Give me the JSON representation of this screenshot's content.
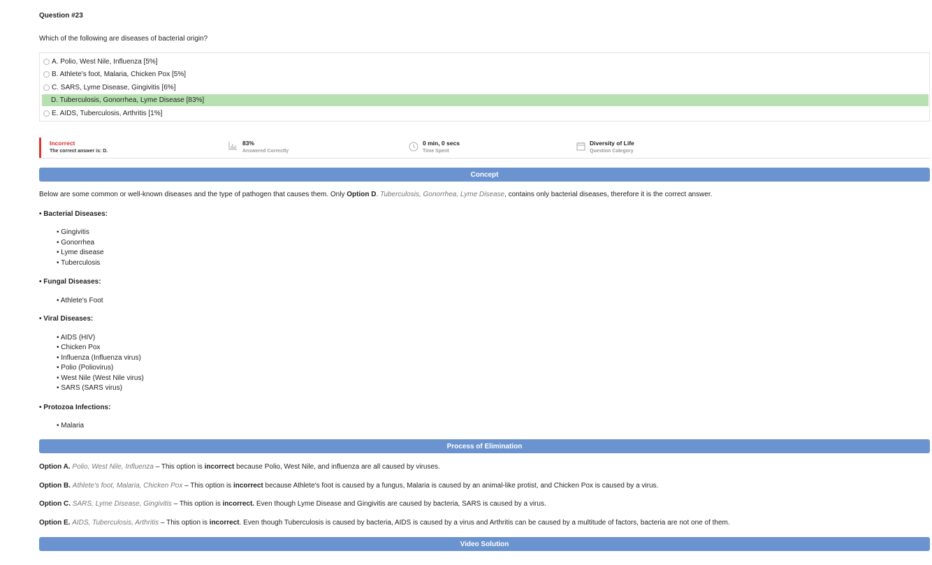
{
  "question": {
    "number": "Question #23",
    "text": "Which of the following are diseases of bacterial origin?",
    "options": [
      {
        "label": "A. Polio, West Nile, Influenza [5%]",
        "selected": false
      },
      {
        "label": "B. Athlete's foot, Malaria, Chicken Pox [5%]",
        "selected": false
      },
      {
        "label": "C. SARS, Lyme Disease, Gingivitis [6%]",
        "selected": false
      },
      {
        "label": "D. Tuberculosis, Gonorrhea, Lyme Disease [83%]",
        "selected": true
      },
      {
        "label": "E. AIDS, Tuberculosis, Arthritis [1%]",
        "selected": false
      }
    ]
  },
  "result": {
    "status": "Incorrect",
    "correct_answer": "The correct answer is: D.",
    "percent": "83%",
    "percent_label": "Answered Correctly",
    "time": "0 min, 0 secs",
    "time_label": "Time Spent",
    "category": "Diversity of Life",
    "category_label": "Question Category",
    "status_color": "#d9302b"
  },
  "concept": {
    "header": "Concept",
    "intro_1": "Below are some common or well-known diseases and the type of pathogen that causes them. Only ",
    "intro_bold": "Option D",
    "intro_2": ". ",
    "intro_italic": "Tuberculosis, Gonorrhea, Lyme Disease",
    "intro_3": ", contains only bacterial diseases, therefore it is the correct answer.",
    "groups": [
      {
        "title": "• Bacterial Diseases:",
        "items": [
          "• Gingivitis",
          "• Gonorrhea",
          "• Lyme disease",
          "• Tuberculosis"
        ]
      },
      {
        "title": "• Fungal Diseases:",
        "items": [
          "• Athlete's Foot"
        ]
      },
      {
        "title": "• Viral Diseases:",
        "items": [
          "• AIDS (HIV)",
          "• Chicken Pox",
          "• Influenza (Influenza virus)",
          "• Polio (Poliovirus)",
          "• West Nile (West Nile virus)",
          "• SARS (SARS virus)"
        ]
      },
      {
        "title": "• Protozoa Infections:",
        "items": [
          "• Malaria"
        ]
      }
    ]
  },
  "elimination": {
    "header": "Process of Elimination",
    "items": [
      {
        "label": "Option A.",
        "italic": "Polio, West Nile, Influenza",
        "pre": " – This option is ",
        "bold": "incorrect",
        "post": " because Polio, West Nile, and influenza are all caused by viruses."
      },
      {
        "label": "Option B.",
        "italic": "Athlete's foot, Malaria, Chicken Pox",
        "pre": " – This option is ",
        "bold": "incorrect",
        "post": " because Athlete's foot is caused by a fungus, Malaria is caused by an animal-like protist, and Chicken Pox is caused by a virus."
      },
      {
        "label": "Option C.",
        "italic": "SARS, Lyme Disease, Gingivitis",
        "pre": " – This option is ",
        "bold": "incorrect.",
        "post": " Even though Lyme Disease and Gingivitis are caused by bacteria, SARS is caused by a virus."
      },
      {
        "label": "Option E.",
        "italic": "AIDS, Tuberculosis, Arthritis",
        "pre": " – This option is ",
        "bold": "incorrect",
        "post": ". Even though Tuberculosis is caused by bacteria, AIDS is caused by a virus and Arthritis can be caused by a multitude of factors, bacteria are not one of them."
      }
    ]
  },
  "video": {
    "header": "Video Solution"
  },
  "colors": {
    "section_bar": "#6a93cf",
    "selected_option": "#b7e1b0",
    "incorrect": "#e0332f"
  }
}
